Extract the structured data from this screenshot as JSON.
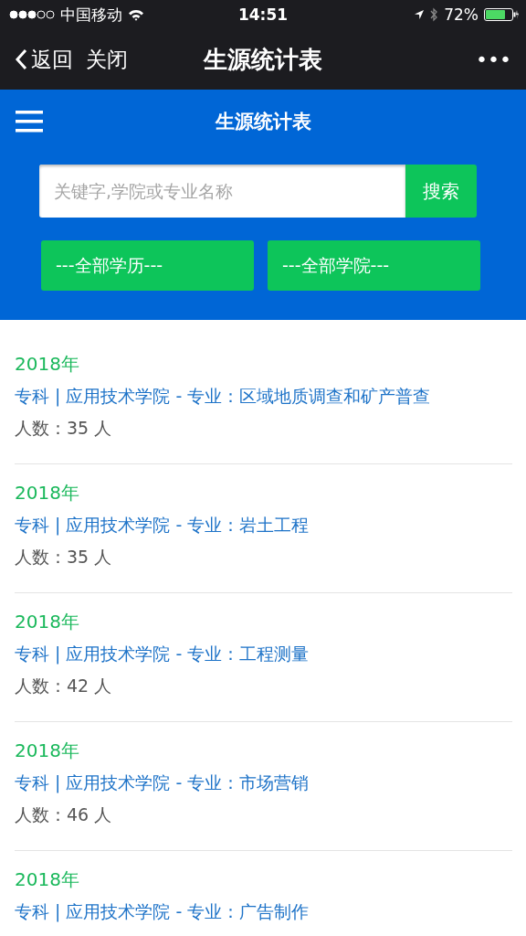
{
  "status_bar": {
    "carrier": "中国移动",
    "time": "14:51",
    "battery": "72%"
  },
  "nav_bar": {
    "back": "返回",
    "close": "关闭",
    "title": "生源统计表",
    "more": "•••"
  },
  "header": {
    "title": "生源统计表"
  },
  "search": {
    "placeholder": "关键字,学院或专业名称",
    "button": "搜索"
  },
  "filters": [
    "---全部学历---",
    "---全部学院---"
  ],
  "records": [
    {
      "year": "2018年",
      "info": "专科 | 应用技术学院 - 专业：区域地质调查和矿产普查",
      "count": "人数：35 人"
    },
    {
      "year": "2018年",
      "info": "专科 | 应用技术学院 - 专业：岩土工程",
      "count": "人数：35 人"
    },
    {
      "year": "2018年",
      "info": "专科 | 应用技术学院 - 专业：工程测量",
      "count": "人数：42 人"
    },
    {
      "year": "2018年",
      "info": "专科 | 应用技术学院 - 专业：市场营销",
      "count": "人数：46 人"
    },
    {
      "year": "2018年",
      "info": "专科 | 应用技术学院 - 专业：广告制作"
    }
  ]
}
